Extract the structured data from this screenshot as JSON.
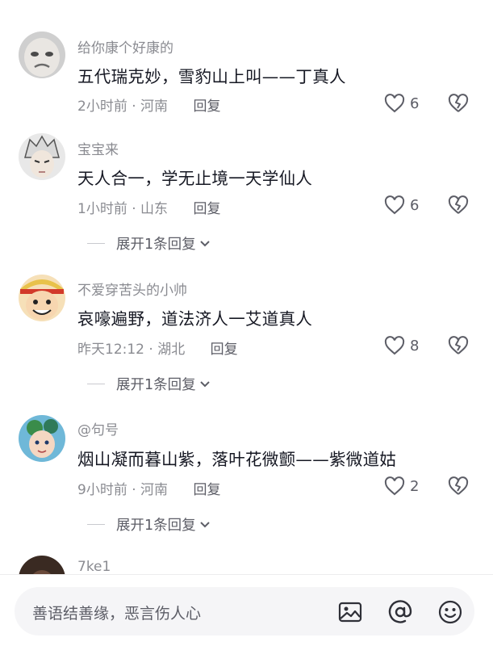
{
  "comments": [
    {
      "username": "给你康个好康的",
      "text": "五代瑞克妙，雪豹山上叫——丁真人",
      "time": "2小时前",
      "location": "河南",
      "reply_label": "回复",
      "likes": "6"
    },
    {
      "username": "宝宝来",
      "text": "天人合一，学无止境一天学仙人",
      "time": "1小时前",
      "location": "山东",
      "reply_label": "回复",
      "likes": "6",
      "expand_label": "展开1条回复"
    },
    {
      "username": "不爱穿苦头的小帅",
      "text": "哀嚎遍野，道法济人一艾道真人",
      "time": "昨天12:12",
      "location": "湖北",
      "reply_label": "回复",
      "likes": "8",
      "expand_label": "展开1条回复"
    },
    {
      "username": "@句号",
      "text": "烟山凝而暮山紫，落叶花微颤——紫微道姑",
      "time": "9小时前",
      "location": "河南",
      "reply_label": "回复",
      "likes": "2",
      "expand_label": "展开1条回复"
    },
    {
      "username": "7ke1"
    }
  ],
  "meta_separator": "·",
  "input": {
    "placeholder": "善语结善缘，恶言伤人心",
    "icons": [
      "image-icon",
      "at-icon",
      "emoji-icon"
    ]
  },
  "colors": {
    "text_primary": "#161823",
    "text_secondary": "#8a8b91",
    "input_bg": "#f5f5f7"
  }
}
